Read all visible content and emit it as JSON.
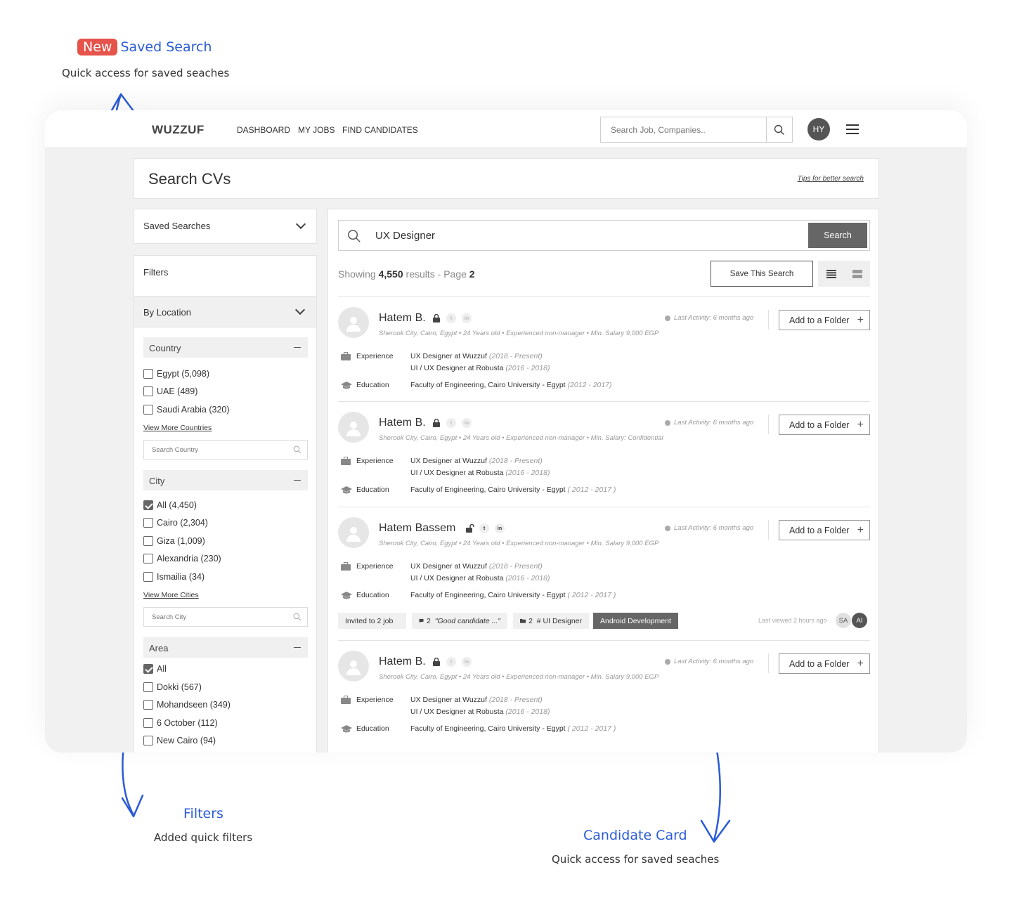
{
  "annotations": {
    "saved_search": {
      "badge": "New",
      "title": "Saved Search",
      "subtitle": "Quick access for saved seaches"
    },
    "filters": {
      "title": "Filters",
      "subtitle": "Added quick filters"
    },
    "candidate_card": {
      "title": "Candidate Card",
      "subtitle": "Quick access for saved seaches"
    },
    "arrow_color": "#2a5bd7"
  },
  "header": {
    "logo": "WUZZUF",
    "nav": [
      "DASHBOARD",
      "MY JOBS",
      "FIND CANDIDATES"
    ],
    "search_placeholder": "Search Job, Companies..",
    "avatar": "HY"
  },
  "page": {
    "title": "Search CVs",
    "tips_link": "Tips for better search"
  },
  "sidebar": {
    "saved_searches_label": "Saved Searches",
    "filters_label": "Filters",
    "by_location_label": "By Location",
    "country": {
      "label": "Country",
      "options": [
        {
          "label": "Egypt (5,098)",
          "checked": false
        },
        {
          "label": "UAE (489)",
          "checked": false
        },
        {
          "label": "Saudi Arabia (320)",
          "checked": false
        }
      ],
      "view_more": "View More Countries",
      "search_placeholder": "Search Country"
    },
    "city": {
      "label": "City",
      "options": [
        {
          "label": "All (4,450)",
          "checked": true
        },
        {
          "label": "Cairo (2,304)",
          "checked": false
        },
        {
          "label": "Giza (1,009)",
          "checked": false
        },
        {
          "label": "Alexandria (230)",
          "checked": false
        },
        {
          "label": "Ismailia (34)",
          "checked": false
        }
      ],
      "view_more": "View More Cities",
      "search_placeholder": "Search City"
    },
    "area": {
      "label": "Area",
      "options": [
        {
          "label": "All",
          "checked": true
        },
        {
          "label": "Dokki (567)",
          "checked": false
        },
        {
          "label": "Mohandseen (349)",
          "checked": false
        },
        {
          "label": "6 October (112)",
          "checked": false
        },
        {
          "label": "New Cairo (94)",
          "checked": false
        }
      ]
    }
  },
  "results": {
    "query": "UX Designer",
    "search_button": "Search",
    "showing_prefix": "Showing",
    "count": "4,550",
    "results_word": "results - Page",
    "page": "2",
    "save_search_button": "Save This Search",
    "candidates": [
      {
        "name": "Hatem B.",
        "meta": "Sherook City, Cairo, Egypt • 24 Years old • Experienced non-manager •  Min. Salary 9,000 EGP",
        "last_activity": "Last Activity: 6 months ago",
        "folder_button": "Add to a Folder",
        "experience_label": "Experience",
        "experience": [
          {
            "title": "UX Designer at Wuzzuf",
            "period": "(2018 - Present)"
          },
          {
            "title": "UI / UX Designer at Robusta",
            "period": "(2016 - 2018)"
          }
        ],
        "education_label": "Education",
        "education": {
          "title": "Faculty of Engineering, Cairo University - Egypt",
          "period": "(2012 - 2017)"
        }
      },
      {
        "name": "Hatem B.",
        "meta": "Sherook City, Cairo, Egypt • 24 Years old • Experienced non-manager •  Min. Salary: Confidential",
        "last_activity": "Last Activity: 6 months ago",
        "folder_button": "Add to a Folder",
        "experience_label": "Experience",
        "experience": [
          {
            "title": "UX Designer at Wuzzuf",
            "period": "(2018 - Present)"
          },
          {
            "title": "UI / UX Designer at Robusta",
            "period": "(2016 - 2018)"
          }
        ],
        "education_label": "Education",
        "education": {
          "title": "Faculty of Engineering, Cairo University - Egypt",
          "period": "( 2012 - 2017 )"
        }
      },
      {
        "name": "Hatem Bassem",
        "meta": "Sherook City, Cairo, Egypt • 24 Years old • Experienced non-manager •  Min. Salary 9,000 EGP",
        "last_activity": "Last Activity: 6 months ago",
        "folder_button": "Add to a Folder",
        "experience_label": "Experience",
        "experience": [
          {
            "title": "UX Designer at Wuzzuf",
            "period": "(2018 - Present)"
          },
          {
            "title": "UI / UX Designer at Robusta",
            "period": "(2016 - 2018)"
          }
        ],
        "education_label": "Education",
        "education": {
          "title": "Faculty of Engineering, Cairo University - Egypt",
          "period": "( 2012 - 2017 )"
        },
        "tags": {
          "invited_prefix": "Invited to",
          "invited_count": "2 job",
          "comments_count": "2",
          "comment_quote": "\"Good candidate ...\"",
          "folders_count": "2",
          "folder_name": "# UI Designer",
          "dark_tag": "Android Development",
          "last_viewed": "Last viewed 2 hours ago",
          "viewers": [
            "SA",
            "AI"
          ]
        }
      },
      {
        "name": "Hatem B.",
        "meta": "Sherook City, Cairo, Egypt • 24 Years old • Experienced non-manager •  Min. Salary 9,000 EGP",
        "last_activity": "Last Activity: 6 months ago",
        "folder_button": "Add to a Folder",
        "experience_label": "Experience",
        "experience": [
          {
            "title": "UX Designer at Wuzzuf",
            "period": "(2018 - Present)"
          },
          {
            "title": "UI / UX Designer at Robusta",
            "period": "(2016 - 2018)"
          }
        ],
        "education_label": "Education",
        "education": {
          "title": "Faculty of Engineering, Cairo University - Egypt",
          "period": "( 2012 - 2017 )"
        }
      }
    ]
  }
}
